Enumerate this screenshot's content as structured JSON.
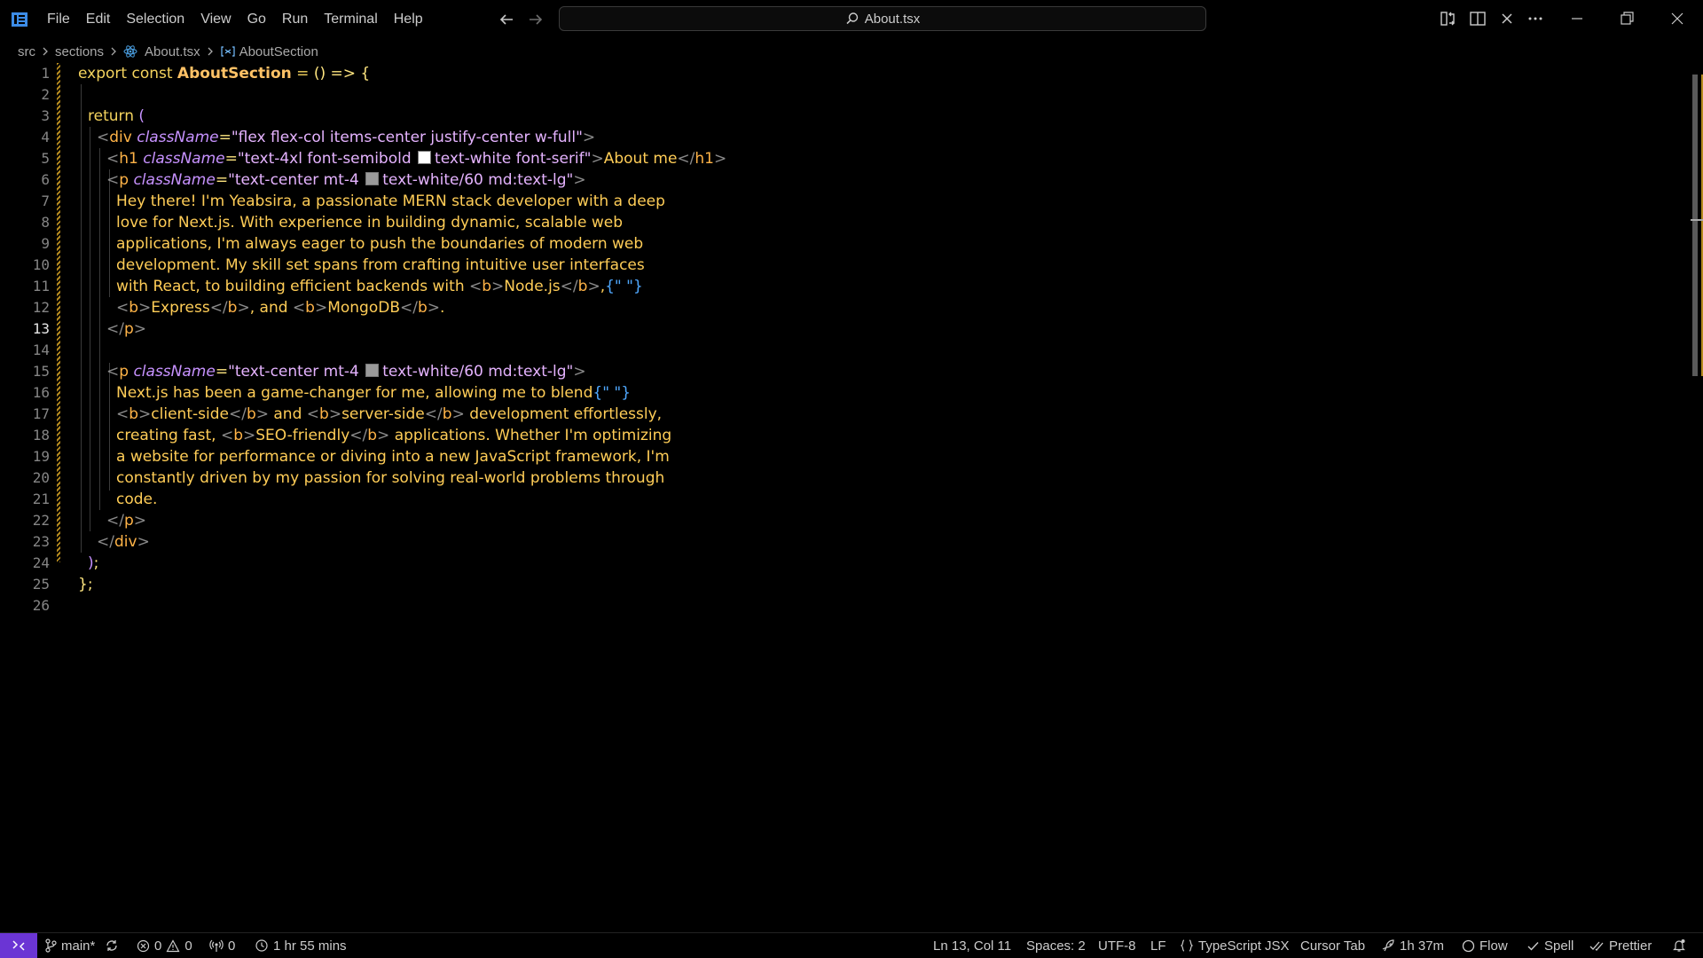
{
  "menu": [
    "File",
    "Edit",
    "Selection",
    "View",
    "Go",
    "Run",
    "Terminal",
    "Help"
  ],
  "command_center": {
    "text": "About.tsx"
  },
  "breadcrumb": {
    "src": "src",
    "sections": "sections",
    "file": "About.tsx",
    "symbol": "AboutSection"
  },
  "lines": [
    "1",
    "2",
    "3",
    "4",
    "5",
    "6",
    "7",
    "8",
    "9",
    "10",
    "11",
    "12",
    "13",
    "14",
    "15",
    "16",
    "17",
    "18",
    "19",
    "20",
    "21",
    "22",
    "23",
    "24",
    "25",
    "26"
  ],
  "active_line": 13,
  "code": {
    "l1": {
      "kw": "export const ",
      "fn": "AboutSection",
      "op": " = ",
      "p": "() => {"
    },
    "l3": {
      "kw": "return ",
      "br": "("
    },
    "l4": {
      "ang1": "<",
      "tag": "div",
      "attr": " className",
      "eq": "=",
      "str": "\"flex flex-col items-center justify-center w-full\"",
      "ang2": ">"
    },
    "l5": {
      "ang1": "<",
      "tag": "h1",
      "attr": " className",
      "eq": "=",
      "str1": "\"text-4xl font-semibold ",
      "str2": "text-white font-serif\"",
      "ang2": ">",
      "txt": "About me",
      "ang3": "</",
      "tag2": "h1",
      "ang4": ">"
    },
    "l6": {
      "ang1": "<",
      "tag": "p",
      "attr": " className",
      "eq": "=",
      "str1": "\"text-center mt-4 ",
      "str2": "text-white/60 md:text-lg\"",
      "ang2": ">"
    },
    "l7": "Hey there! I'm Yeabsira, a passionate MERN stack developer with a deep",
    "l8": "love for Next.js. With experience in building dynamic, scalable web",
    "l9": "applications, I'm always eager to push the boundaries of modern web",
    "l10": "development. My skill set spans from crafting intuitive user interfaces",
    "l11": {
      "txt": "with React, to building efficient backends with ",
      "a1": "<",
      "b": "b",
      "a2": ">",
      "node": "Node.js",
      "a3": "</",
      "b2": "b",
      "a4": ">",
      "comma": ",",
      "brace": "{\" \"}"
    },
    "l12": {
      "a1": "<",
      "b": "b",
      "a2": ">",
      "express": "Express",
      "a3": "</",
      "b2": "b",
      "a4": ">",
      "and": ", and ",
      "a5": "<",
      "b3": "b",
      "a6": ">",
      "mongo": "MongoDB",
      "a7": "</",
      "b4": "b",
      "a8": ">",
      "dot": "."
    },
    "l13": {
      "a1": "</",
      "tag": "p",
      "a2": ">"
    },
    "l15": {
      "ang1": "<",
      "tag": "p",
      "attr": " className",
      "eq": "=",
      "str1": "\"text-center mt-4 ",
      "str2": "text-white/60 md:text-lg\"",
      "ang2": ">"
    },
    "l16": {
      "txt": "Next.js has been a game-changer for me, allowing me to blend",
      "brace": "{\" \"}"
    },
    "l17": {
      "a1": "<",
      "b": "b",
      "a2": ">",
      "cs": "client-side",
      "a3": "</",
      "b2": "b",
      "a4": ">",
      "and": " and ",
      "a5": "<",
      "b3": "b",
      "a6": ">",
      "ss": "server-side",
      "a7": "</",
      "b4": "b",
      "a8": ">",
      "rest": " development effortlessly,"
    },
    "l18": {
      "txt": "creating fast, ",
      "a1": "<",
      "b": "b",
      "a2": ">",
      "seo": "SEO-friendly",
      "a3": "</",
      "b2": "b",
      "a4": ">",
      "rest": " applications. Whether I'm optimizing"
    },
    "l19": "a website for performance or diving into a new JavaScript framework, I'm",
    "l20": "constantly driven by my passion for solving real-world problems through",
    "l21": "code.",
    "l22": {
      "a1": "</",
      "tag": "p",
      "a2": ">"
    },
    "l23": {
      "a1": "</",
      "tag": "div",
      "a2": ">"
    },
    "l24": {
      "br": ")",
      "semi": ";"
    },
    "l25": "};"
  },
  "status": {
    "branch": "main*",
    "errors": "0",
    "warnings": "0",
    "ports": "0",
    "time": "1 hr 55 mins",
    "position": "Ln 13, Col 11",
    "spaces": "Spaces: 2",
    "encoding": "UTF-8",
    "eol": "LF",
    "language": "TypeScript JSX",
    "cursor": "Cursor Tab",
    "session": "1h 37m",
    "flow": "Flow",
    "spell": "Spell",
    "prettier": "Prettier"
  },
  "colors": {
    "accent": "#6b35d4",
    "modified": "#b58a1f",
    "swatch_white": "#ffffff",
    "swatch_gray": "#9a9a9a"
  }
}
